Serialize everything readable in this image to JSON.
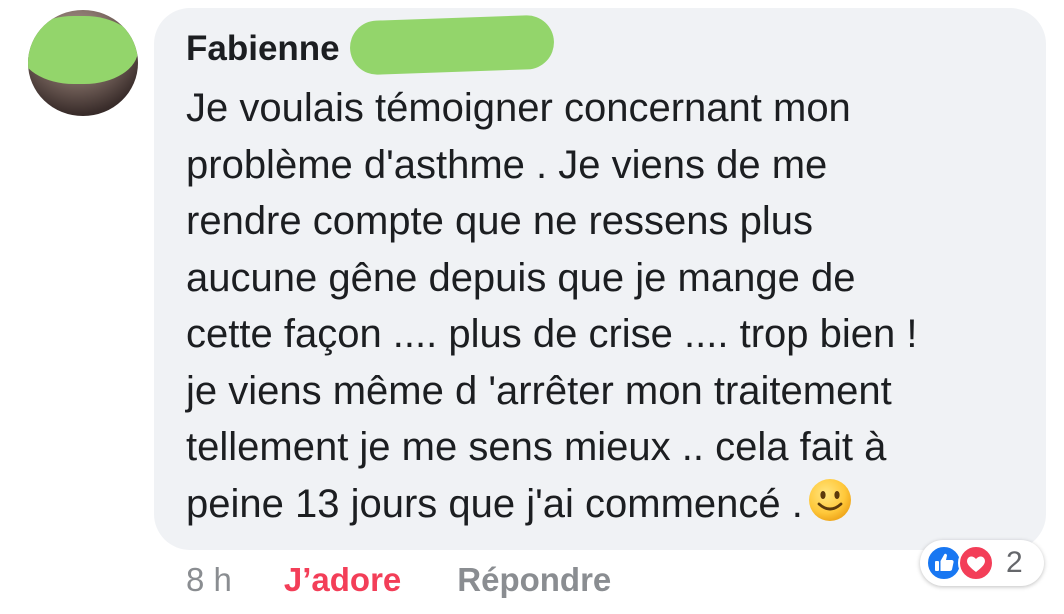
{
  "comment": {
    "author": "Fabienne",
    "lines": [
      "Je voulais témoigner concernant mon",
      "problème d'asthme . Je  viens de me",
      "rendre compte que ne ressens plus",
      "aucune gêne depuis que je mange de",
      "cette façon .... plus de crise .... trop bien !",
      "je viens même d 'arrêter mon traitement",
      "tellement je me sens mieux .. cela fait à",
      "peine 13 jours que j'ai commencé ."
    ],
    "emoji": "slightly-smiling-face-icon"
  },
  "actions": {
    "time": "8 h",
    "reaction_label": "J’adore",
    "reply_label": "Répondre"
  },
  "reactions": {
    "icons": [
      "like-icon",
      "love-icon"
    ],
    "count": "2"
  },
  "colors": {
    "bubble": "#f0f2f5",
    "text": "#1c1e21",
    "love_red": "#f33e58",
    "like_blue": "#1877f2",
    "muted": "#8a8d91",
    "redaction_green": "#93d56b"
  }
}
